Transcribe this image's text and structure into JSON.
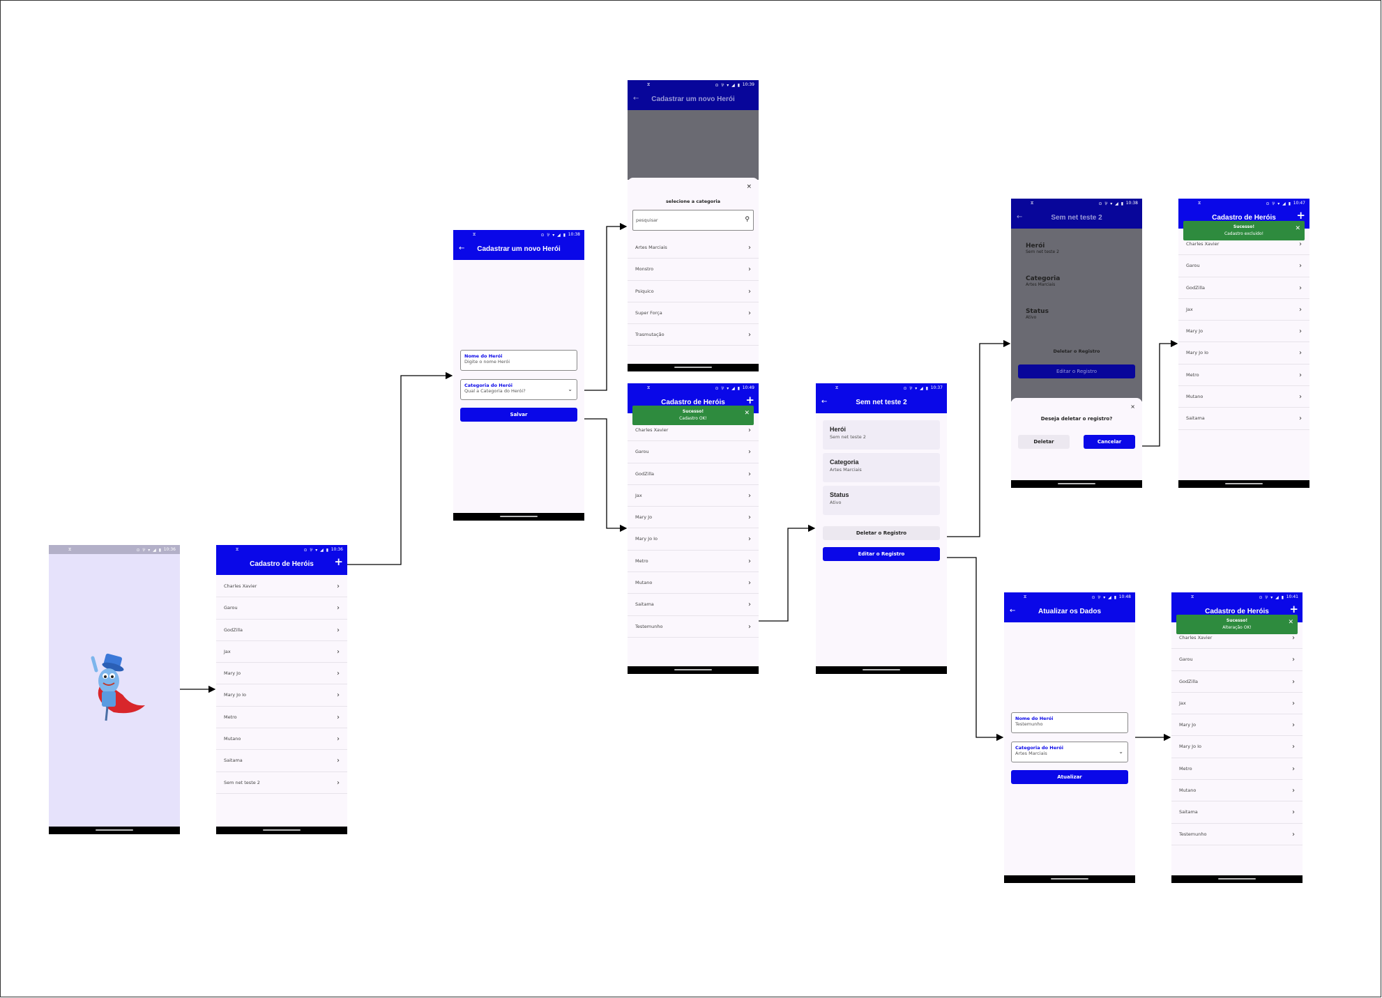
{
  "status": {
    "logo": "⧖",
    "signal": "⊙ ⅌ ▾ ◢ ▮",
    "times": [
      "10:38",
      "10:39",
      "10:38",
      "10:49",
      "10:37",
      "10:38",
      "10:47",
      "10:48",
      "10:41",
      "10:36",
      "10:38"
    ]
  },
  "splash": {
    "time": "10:36"
  },
  "list_screen": {
    "title": "Cadastro de Heróis",
    "time": "10:36",
    "items": [
      "Charles Xavier",
      "Garou",
      "GodZilla",
      "Jax",
      "Mary Jo",
      "Mary Jo Io",
      "Metro",
      "Mutano",
      "Saitama",
      "Sem net teste 2"
    ]
  },
  "new_hero": {
    "title": "Cadastrar um novo Herói",
    "time": "10:38",
    "name_label": "Nome do Herói",
    "name_placeholder": "Digite o nome Herói",
    "cat_label": "Categoria do Herói",
    "cat_placeholder": "Qual a Categoria do Herói?",
    "save": "Salvar"
  },
  "category_picker": {
    "title": "Cadastrar um novo Herói",
    "time": "10:39",
    "close": "×",
    "heading": "selecione a categoria",
    "search_placeholder": "pesquisar",
    "options": [
      "Artes Marciais",
      "Monstro",
      "Psiquico",
      "Super Força",
      "Trasmutação"
    ]
  },
  "list_success": {
    "title": "Cadastro de Heróis",
    "time": "10:49",
    "toast_title": "Sucesso!",
    "toast_msg": "Cadastro OK!",
    "items": [
      "Charles Xavier",
      "Garou",
      "GodZilla",
      "Jax",
      "Mary Jo",
      "Mary Jo Io",
      "Metro",
      "Mutano",
      "Saitama",
      "Testemunho"
    ]
  },
  "detail": {
    "title": "Sem net teste 2",
    "time": "10:37",
    "cards": [
      {
        "label": "Herói",
        "value": "Sem net teste 2"
      },
      {
        "label": "Categoria",
        "value": "Artes Marciais"
      },
      {
        "label": "Status",
        "value": "Ativo"
      }
    ],
    "delete": "Deletar o Registro",
    "edit": "Editar o Registro"
  },
  "delete_confirm": {
    "title": "Sem net teste 2",
    "time": "10:38",
    "cards": [
      {
        "label": "Herói",
        "value": "Sem net teste 2"
      },
      {
        "label": "Categoria",
        "value": "Artes Marciais"
      },
      {
        "label": "Status",
        "value": "Ativo"
      }
    ],
    "delete": "Deletar o Registro",
    "edit": "Editar o Registro",
    "question": "Deseja deletar o registro?",
    "btn_delete": "Deletar",
    "btn_cancel": "Cancelar"
  },
  "list_deleted": {
    "title": "Cadastro de Heróis",
    "time": "10:47",
    "toast_title": "Sucesso!",
    "toast_msg": "Cadastro excluido!",
    "items": [
      "Charles Xavier",
      "Garou",
      "GodZilla",
      "Jax",
      "Mary Jo",
      "Mary Jo Io",
      "Metro",
      "Mutano",
      "Saitama"
    ]
  },
  "update": {
    "title": "Atualizar os Dados",
    "time": "10:48",
    "name_label": "Nome do Herói",
    "name_value": "Testemunho",
    "cat_label": "Categoria do Herói",
    "cat_value": "Artes Marciais",
    "button": "Atualizar"
  },
  "list_updated": {
    "title": "Cadastro de Heróis",
    "time": "10:41",
    "toast_title": "Sucesso!",
    "toast_msg": "Alteração OK!",
    "items": [
      "Charles Xavier",
      "Garou",
      "GodZilla",
      "Jax",
      "Mary Jo",
      "Mary Jo Io",
      "Metro",
      "Mutano",
      "Saitama",
      "Testemunho"
    ]
  },
  "icons": {
    "back": "arrow-left-icon",
    "add": "plus-icon",
    "chevron": "chevron-right-icon",
    "search": "search-icon",
    "dropdown": "chevron-down-icon",
    "close": "close-icon"
  },
  "colors": {
    "brand": "#0a08e8",
    "success": "#2e8b3e",
    "splash_bg": "#e6e2fb",
    "background": "#fbf7fd"
  }
}
